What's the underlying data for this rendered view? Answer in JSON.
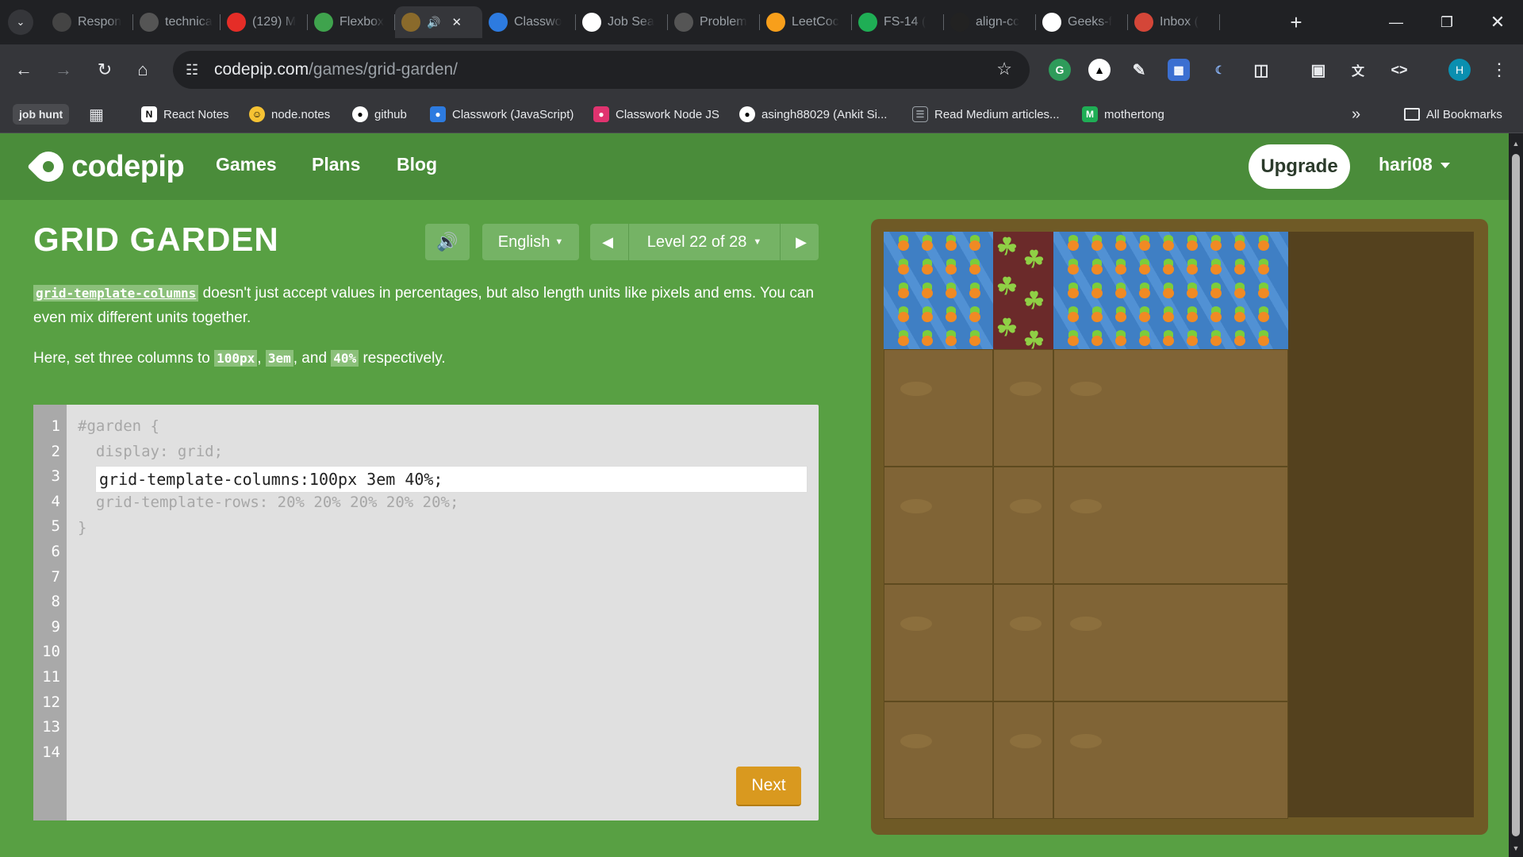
{
  "browser": {
    "tabs": [
      {
        "title": "Respon",
        "icon": "openai-icon",
        "color": "#444"
      },
      {
        "title": "technica",
        "icon": "globe-icon",
        "color": "#555"
      },
      {
        "title": "(129) M",
        "icon": "youtube-icon",
        "color": "#e52d27"
      },
      {
        "title": "Flexbox",
        "icon": "frog-icon",
        "color": "#3fa34d"
      },
      {
        "title": "",
        "icon": "garden-icon",
        "color": "#8a6a2b",
        "active": true
      },
      {
        "title": "Classwo",
        "icon": "classroom-icon",
        "color": "#2d7be0"
      },
      {
        "title": "Job Sea",
        "icon": "info-icon",
        "color": "#fff"
      },
      {
        "title": "Problem",
        "icon": "problem-icon",
        "color": "#555"
      },
      {
        "title": "LeetCoc",
        "icon": "leetcode-icon",
        "color": "#f89f1b"
      },
      {
        "title": "FS-14 (",
        "icon": "g-icon",
        "color": "#1fae55"
      },
      {
        "title": "align-cc",
        "icon": "medium-icon",
        "color": "#222"
      },
      {
        "title": "Geeks-f",
        "icon": "github-icon",
        "color": "#fff"
      },
      {
        "title": "Inbox (",
        "icon": "gmail-icon",
        "color": "#d44638"
      }
    ],
    "new_tab_label": "+",
    "url_host": "codepip.com",
    "url_path": "/games/grid-garden/",
    "profile_initial": "H",
    "bookmarks": [
      {
        "label": "job hunt",
        "icon": "folder-chip"
      },
      {
        "label": "",
        "icon": "apps-grid-icon"
      },
      {
        "label": "React Notes",
        "icon": "notion-icon"
      },
      {
        "label": "node.notes",
        "icon": "smiley-icon"
      },
      {
        "label": "github",
        "icon": "github-icon"
      },
      {
        "label": "Classwork (JavaScript)",
        "icon": "classroom-icon"
      },
      {
        "label": "Classwork  Node JS",
        "icon": "classroom-pink-icon"
      },
      {
        "label": "asingh88029 (Ankit Si...",
        "icon": "github-icon"
      },
      {
        "label": "Read Medium articles...",
        "icon": "doc-icon"
      },
      {
        "label": "mothertong",
        "icon": "m-icon"
      }
    ],
    "all_bookmarks_label": "All Bookmarks",
    "more_bookmarks_label": "»"
  },
  "site": {
    "logo_text": "codepip",
    "nav": [
      "Games",
      "Plans",
      "Blog"
    ],
    "upgrade_label": "Upgrade",
    "username": "hari08"
  },
  "game": {
    "title": "GRID GARDEN",
    "language": "English",
    "level_label": "Level 22 of 28",
    "desc1_code": "grid-template-columns",
    "desc1_text": " doesn't just accept values in percentages, but also length units like pixels and ems. You can even mix different units together.",
    "desc2_pre": "Here, set three columns to ",
    "desc2_c1": "100px",
    "desc2_sep1": ", ",
    "desc2_c2": "3em",
    "desc2_sep2": ", and ",
    "desc2_c3": "40%",
    "desc2_post": " respectively.",
    "line_numbers": [
      "1",
      "2",
      "3",
      "4",
      "5",
      "6",
      "7",
      "8",
      "9",
      "10",
      "11",
      "12",
      "13",
      "14"
    ],
    "code_line1": "#garden {",
    "code_line2": "  display: grid;",
    "code_input": "grid-template-columns:100px 3em 40%;",
    "code_line4": "  grid-template-rows: 20% 20% 20% 20% 20%;",
    "code_line5": "}",
    "next_label": "Next",
    "colors": {
      "background": "#58a043",
      "nav": "#4a8c3a",
      "button": "#75b365",
      "next": "#d9991f",
      "soil": "#806436"
    }
  }
}
